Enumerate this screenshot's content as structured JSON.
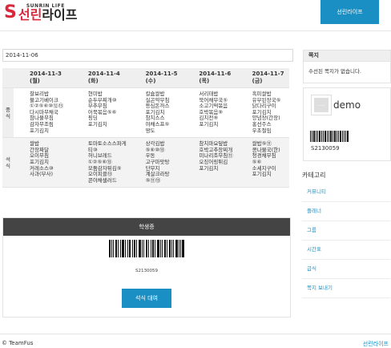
{
  "header": {
    "logo_en": "SUNRIN LIFE",
    "logo_s": "S",
    "logo_kor_red": "선린",
    "logo_kor_dark": "라이프",
    "nav_button": "선린라이프"
  },
  "date": {
    "value": "2014-11-06"
  },
  "meals": {
    "days": [
      {
        "label": "2014-11-3 (월)"
      },
      {
        "label": "2014-11-4 (화)"
      },
      {
        "label": "2014-11-5 (수)"
      },
      {
        "label": "2014-11-6 (목)"
      },
      {
        "label": "2014-11-7 (금)"
      }
    ],
    "lunch_label": "중\n식",
    "dinner_label": "석\n식",
    "lunch": [
      "찰보리밥\n불고기베이크\n①②⑤⑥⑩⑫⑬\n다시마무채국\n참나물무침\n감자무조림\n포기김치",
      "현미밥\n순두부찌개⑩\n부추무침\n어묵볶음⑤⑥\n핑딩\n포기김치",
      "칼슘쌀밥\n실곤약무침\n등심돈까스\n포기김치\n참치스스\n야채스프⑤\n땅도",
      "서리태밥\n북어채무국⑤\n소고기떡볶음\n호박볶음⑨\n김치전⑨\n포기김치",
      "흑미쌀밥\n유부된장국⑤\n닭다리구이\n포기김치\n양념장(간장)\n홍선주스\n우초절임"
    ],
    "dinner": [
      "쌀밥\n간장짜달\n오이무침\n포기김치\n커레소스⑩\n사과(부사)",
      "토마토소스스파게티⑩\n허니브레드\n①②⑤⑥⑬\n모둠감자튀김⑤\n오이피클⑬\n콘야채샐러드",
      "상각김밥\n⑤⑥⑩⑬\n우동\n고구마맛탕\n단무지\n계살크라탕⑤⑪⑬",
      "참치마요덮밥\n호박고추장찌개\n미나리조무침⑪\n오징어링튀김\n포기김치",
      "쌀밥⑤⑪\n콩나물국(한)\n청경채무침\n⑤⑥\n소세지구이\n포기김치"
    ]
  },
  "student_card": {
    "title": "학생증",
    "code": "S2130059",
    "button": "석식 대여"
  },
  "notes": {
    "title": "쪽지",
    "body": "수선된 쪽지가 없습니다."
  },
  "profile": {
    "avatar_placeholder": "----",
    "username": "demo",
    "code": "S2130059"
  },
  "categories": {
    "title": "카테고리",
    "items": [
      "커뮤니티",
      "플래너",
      "그룹",
      "시간표",
      "급식",
      "쪽지 보내기"
    ]
  },
  "footer": {
    "copyright": "© TeamFus",
    "link": "선린라이프"
  }
}
